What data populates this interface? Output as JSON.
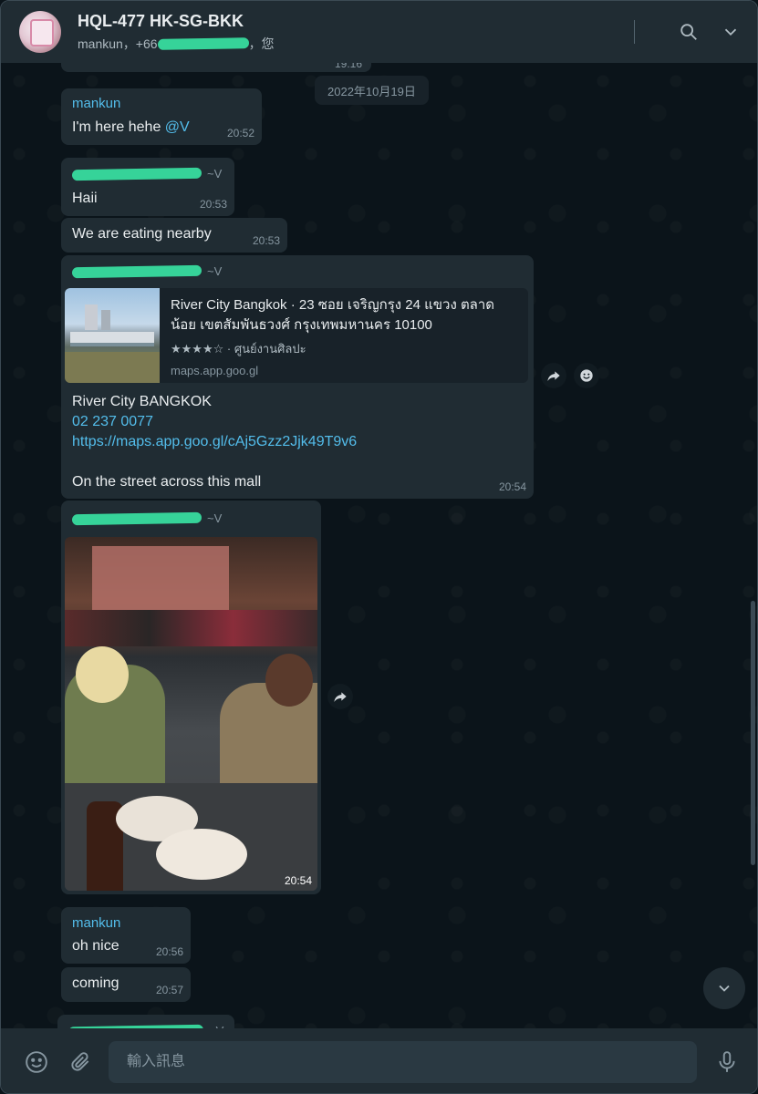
{
  "header": {
    "title": "HQL-477 HK-SG-BKK",
    "subtitle_prefix": "mankun，+66",
    "subtitle_suffix": "，您"
  },
  "chat": {
    "prev_time": "19:16",
    "date_separator": "2022年10月19日",
    "messages": [
      {
        "sender": "mankun",
        "text": "I'm here hehe ",
        "mention": "@V",
        "time": "20:52"
      },
      {
        "sender_suffix": "~V",
        "text": "Haii",
        "time": "20:53"
      },
      {
        "text": "We are eating nearby",
        "time": "20:53"
      },
      {
        "sender_suffix": "~V",
        "link_preview": {
          "title": "River City Bangkok · 23 ซอย เจริญกรุง 24 แขวง ตลาดน้อย เขตสัมพันธวงศ์ กรุงเทพมหานคร 10100",
          "rating": "★★★★☆ · ศูนย์งานศิลปะ",
          "domain": "maps.app.goo.gl"
        },
        "line1": "River City BANGKOK",
        "phone": "02 237 0077",
        "url": "https://maps.app.goo.gl/cAj5Gzz2Jjk49T9v6",
        "line2": "On the street across this mall",
        "time": "20:54"
      },
      {
        "sender_suffix": "~V",
        "photo": true,
        "time": "20:54"
      },
      {
        "sender": "mankun",
        "text": "oh nice",
        "time": "20:56"
      },
      {
        "text": "coming",
        "time": "20:57"
      },
      {
        "sender_suffix": "~V"
      }
    ]
  },
  "composer": {
    "placeholder": "輸入訊息"
  },
  "icons": [
    "search-icon",
    "chevron-down-icon",
    "forward-icon",
    "emoji-icon",
    "attach-icon",
    "mic-icon"
  ],
  "colors": {
    "header_bg": "#202c33",
    "chat_bg": "#0b141a",
    "bubble_bg": "#202c33",
    "accent": "#53bdeb",
    "redaction": "#36d399"
  }
}
